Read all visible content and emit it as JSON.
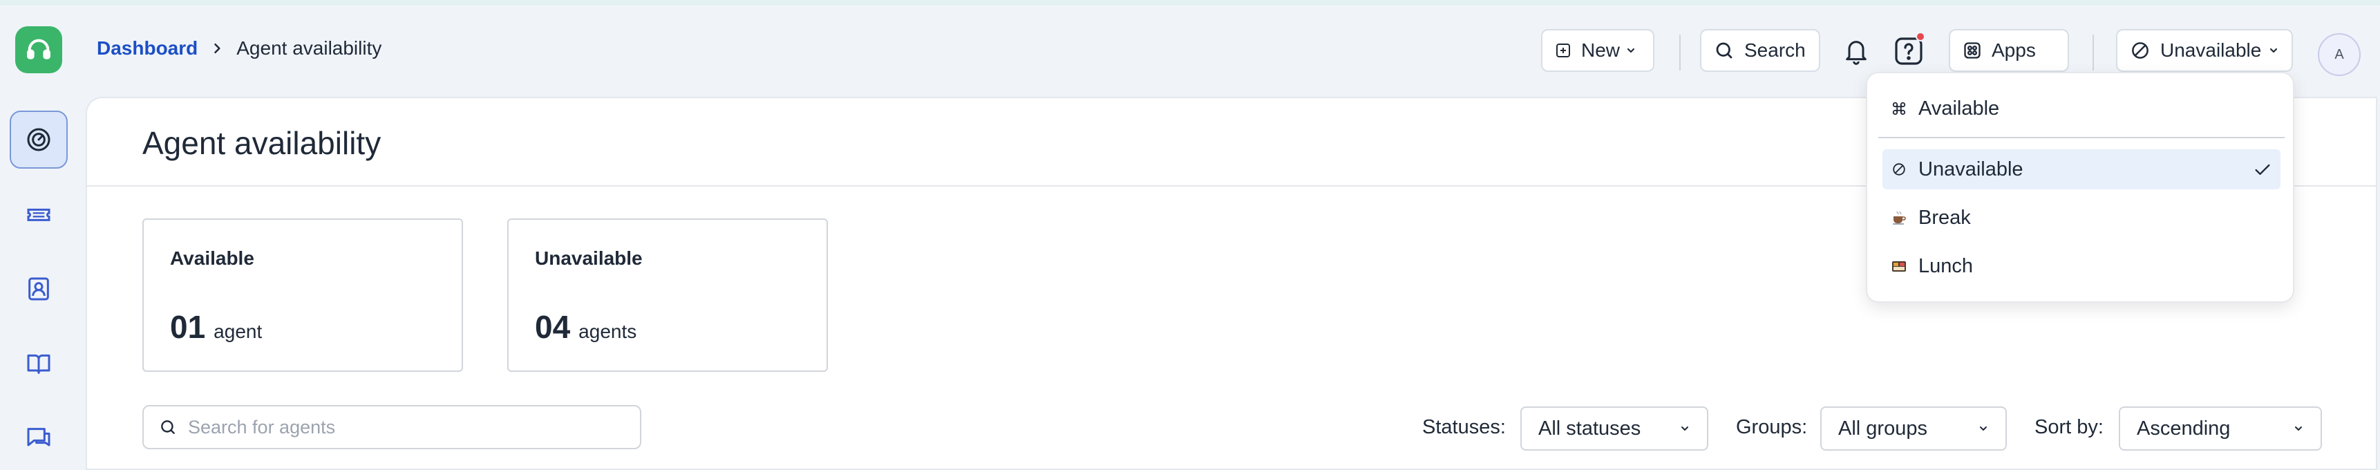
{
  "header": {
    "breadcrumb": {
      "root": "Dashboard",
      "current": "Agent availability"
    },
    "new_label": "New",
    "search_label": "Search",
    "apps_label": "Apps",
    "status_label": "Unavailable",
    "avatar_initial": "A"
  },
  "sidebar": {
    "items": [
      {
        "icon": "dashboard-gauge-icon",
        "active": true
      },
      {
        "icon": "ticket-icon",
        "active": false
      },
      {
        "icon": "contact-icon",
        "active": false
      },
      {
        "icon": "book-icon",
        "active": false
      },
      {
        "icon": "chat-icon",
        "active": false
      }
    ]
  },
  "main": {
    "title": "Agent availability",
    "cards": [
      {
        "label": "Available",
        "count": "01",
        "unit": "agent"
      },
      {
        "label": "Unavailable",
        "count": "04",
        "unit": "agents"
      }
    ],
    "search_placeholder": "Search for agents",
    "filters": {
      "statuses_label": "Statuses:",
      "statuses_value": "All statuses",
      "groups_label": "Groups:",
      "groups_value": "All groups",
      "sort_label": "Sort by:",
      "sort_value": "Ascending"
    }
  },
  "status_menu": {
    "items": [
      {
        "label": "Available",
        "icon": "command-icon",
        "selected": false
      },
      {
        "label": "Unavailable",
        "icon": "unavailable-icon",
        "selected": true
      },
      {
        "label": "Break",
        "icon": "coffee-icon",
        "selected": false
      },
      {
        "label": "Lunch",
        "icon": "lunch-icon",
        "selected": false
      }
    ]
  },
  "colors": {
    "brand": "#3bb56a",
    "link": "#1d4fc4",
    "selected_bg": "#e8f0fb",
    "notification_dot": "#e5484d"
  }
}
